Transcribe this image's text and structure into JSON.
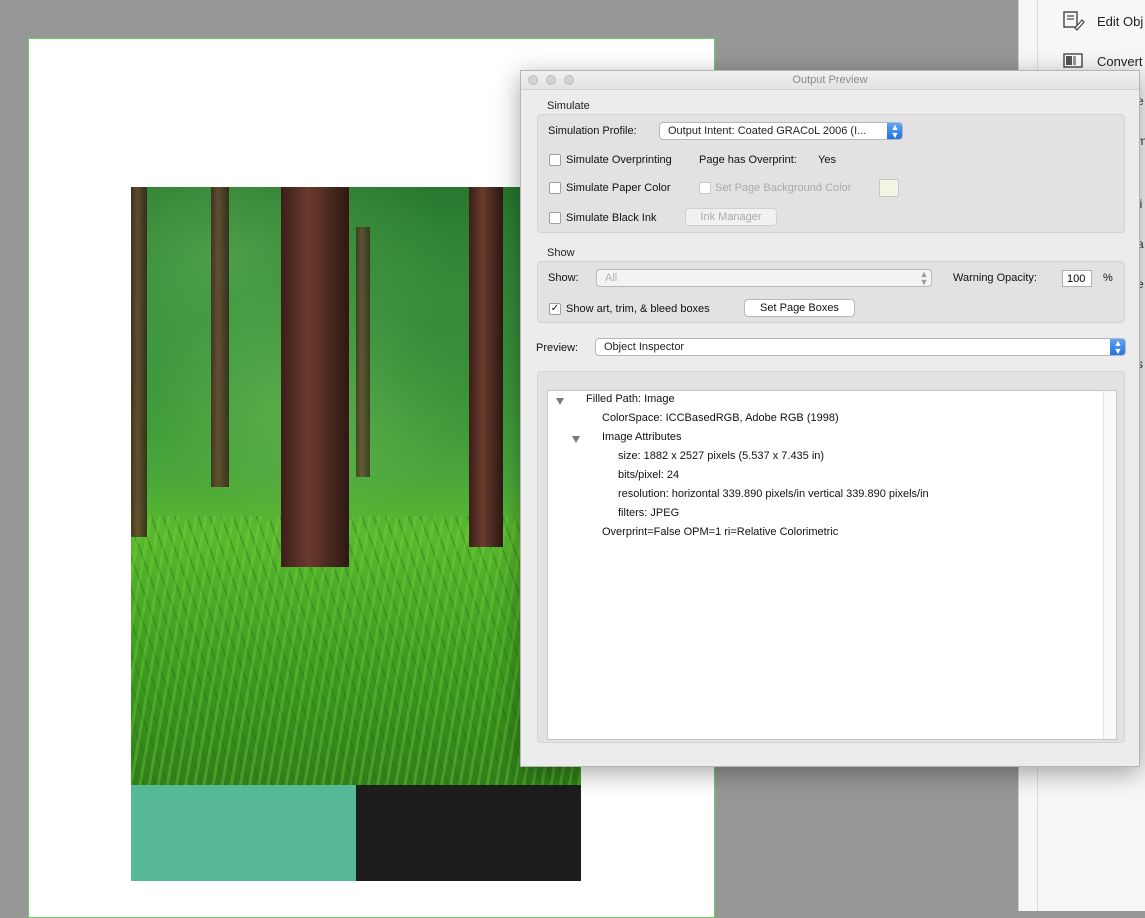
{
  "dialog": {
    "title": "Output Preview",
    "simulate": {
      "section_label": "Simulate",
      "profile_label": "Simulation Profile:",
      "profile_value": "Output Intent: Coated GRACoL 2006 (I...",
      "simulate_overprinting": {
        "label": "Simulate Overprinting",
        "checked": false
      },
      "page_has_overprint_label": "Page has Overprint:",
      "page_has_overprint_value": "Yes",
      "simulate_paper_color": {
        "label": "Simulate Paper Color",
        "checked": false
      },
      "set_page_background_color": {
        "label": "Set Page Background Color",
        "checked": false,
        "enabled": false
      },
      "simulate_black_ink": {
        "label": "Simulate Black Ink",
        "checked": false
      },
      "ink_manager_label": "Ink Manager"
    },
    "show": {
      "section_label": "Show",
      "show_label": "Show:",
      "show_value": "All",
      "warning_opacity_label": "Warning Opacity:",
      "warning_opacity_value": "100",
      "percent_label": "%",
      "show_boxes": {
        "label": "Show art, trim, & bleed boxes",
        "checked": true
      },
      "set_page_boxes_label": "Set Page Boxes"
    },
    "preview": {
      "label": "Preview:",
      "value": "Object Inspector"
    },
    "inspector": {
      "rows": [
        {
          "text": "Filled Path: Image",
          "expanded": true
        },
        {
          "text": "ColorSpace: ICCBasedRGB, Adobe RGB (1998)"
        },
        {
          "text": "Image Attributes",
          "expanded": true
        },
        {
          "text": "size: 1882 x 2527 pixels (5.537 x 7.435 in)"
        },
        {
          "text": "bits/pixel: 24"
        },
        {
          "text": "resolution: horizontal 339.890 pixels/in vertical 339.890 pixels/in"
        },
        {
          "text": "filters: JPEG"
        },
        {
          "text": "Overprint=False OPM=1 ri=Relative Colorimetric"
        }
      ]
    }
  },
  "tools_panel": {
    "items": [
      {
        "label": "Edit Obj",
        "icon": "edit-object-icon"
      },
      {
        "label": "Convert",
        "icon": "convert-icon"
      }
    ],
    "fragments": [
      "e",
      "m",
      "li",
      "a",
      "e",
      "s"
    ]
  },
  "document": {
    "swatch_colors": [
      "#58b998",
      "#1d1d1d"
    ]
  }
}
